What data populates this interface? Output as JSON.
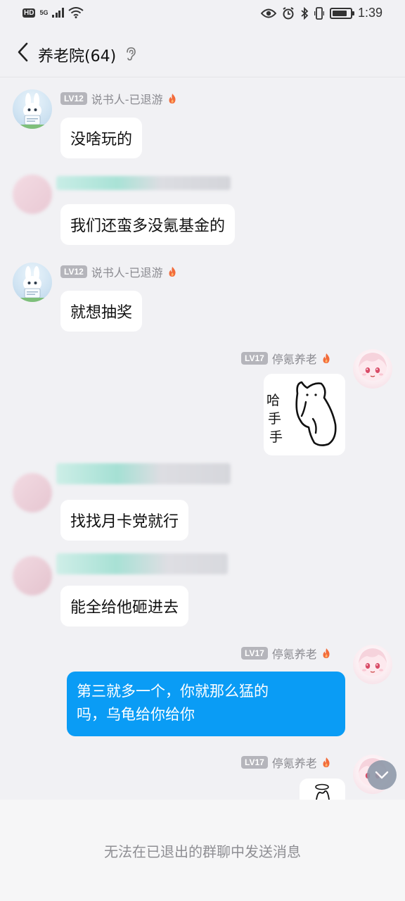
{
  "status_bar": {
    "hd_label": "HD",
    "network_label": "5G",
    "time": "1:39",
    "battery_level": 0.85
  },
  "header": {
    "title": "养老院(64)"
  },
  "messages": [
    {
      "sender": {
        "level": "LV12",
        "nickname": "说书人-已退游"
      },
      "text": "没啥玩的"
    },
    {
      "sender": {
        "nickname": ""
      },
      "text": "我们还蛮多没氪基金的"
    },
    {
      "sender": {
        "level": "LV12",
        "nickname": "说书人-已退游"
      },
      "text": "就想抽奖"
    },
    {
      "sender": {
        "level": "LV17",
        "nickname": "停氪养老"
      },
      "sticker_text": "哈手手"
    },
    {
      "sender": {
        "nickname": ""
      },
      "text": "找找月卡党就行"
    },
    {
      "sender": {
        "nickname": ""
      },
      "text": "能全给他砸进去"
    },
    {
      "sender": {
        "level": "LV17",
        "nickname": "停氪养老"
      },
      "text_line1": "第三就多一个，你就那么猛的",
      "text_line2": "吗，乌龟给你给你"
    },
    {
      "sender": {
        "level": "LV17",
        "nickname": "停氪养老"
      }
    }
  ],
  "footer": {
    "notice": "无法在已退出的群聊中发送消息"
  },
  "colors": {
    "background": "#f1f1f4",
    "self_bubble": "#0a9cf5",
    "level_badge": "#b5b5bb",
    "flame": "#f26b3a"
  }
}
